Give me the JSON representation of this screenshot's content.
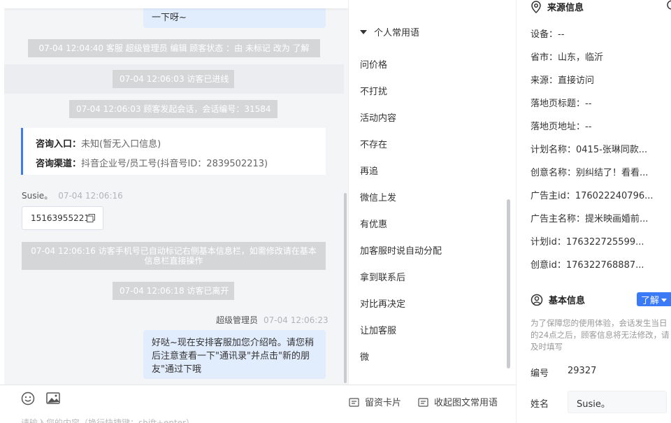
{
  "chat": {
    "top_bubble_text": "一下呀~",
    "system_messages": [
      "07-04 12:04:40 客服 超级管理员 编辑 顾客状态 ：由 未标记 改为 了解",
      "07-04 12:06:03 访客已进线",
      "07-04 12:06:03 顾客发起会话，会话编号：31584"
    ],
    "entry_card": {
      "entry_label": "咨询入口：",
      "entry_value": "未知(暂无入口信息)",
      "channel_label": "咨询渠道：",
      "channel_value": "抖音企业号/员工号(抖音号ID：2839502213)"
    },
    "visitor_name": "Susie。",
    "visitor_time": "07-04 12:06:16",
    "visitor_phone": "15163955221",
    "auto_notice": "07-04 12:06:16 访客手机号已自动标记右侧基本信息栏，如需修改请在基本信息栏直接操作",
    "left_notice": "07-04 12:06:18 访客已离开",
    "agent_name": "超级管理员",
    "agent_time": "07-04 12:06:23",
    "agent_message": "好哒~现在安排客服加您介绍哈。请您稍后注意查看一下\"通讯录\"并点击\"新的朋友\"通过下哦"
  },
  "composer": {
    "lead_card_label": "留资卡片",
    "collapse_label": "收起图文常用语",
    "placeholder": "请输入您的内容（换行快捷键：shift+enter）"
  },
  "phrases": {
    "group_label": "个人常用语",
    "items": [
      "问价格",
      "不打扰",
      "活动内容",
      "不存在",
      "再追",
      "微信上发",
      "有优惠",
      "加客服时说自动分配",
      "拿到联系后",
      "对比再决定",
      "让加客服",
      "微"
    ]
  },
  "right": {
    "source_title": "来源信息",
    "source_rows": [
      "设备：--",
      "省市：山东，临沂",
      "来源：直接访问",
      "落地页标题：--",
      "落地页地址：--",
      "计划名称：0415-张琳同款...",
      "创意名称：别纠结了！看看...",
      "广告主id：176022240796...",
      "广告主名称：提米映画婚前...",
      "计划id：176322725599...",
      "创意id：176322768887..."
    ],
    "basic_title": "基本信息",
    "status_tag": "了解",
    "notice": "为了保障您的使用体验，会话发生当日的24点之后，顾客信息将无法修改，请及时填写",
    "id_label": "编号",
    "id_value": "29327",
    "name_label": "姓名",
    "name_value": "Susie。"
  },
  "colors": {
    "accent": "#3a7af7",
    "agent_bubble": "#e1ecfd",
    "system_bg": "#d5d6d8"
  }
}
